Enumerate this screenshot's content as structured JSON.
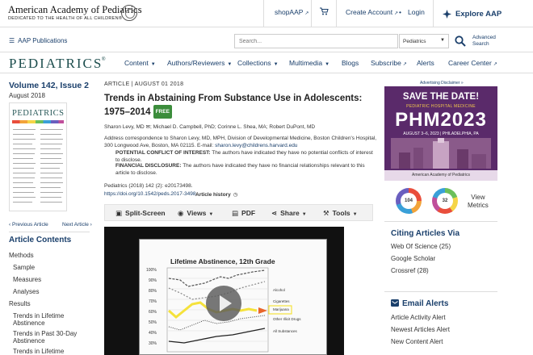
{
  "header": {
    "org_name": "American Academy of Pediatrics",
    "org_tagline": "DEDICATED TO THE HEALTH OF ALL CHILDREN®",
    "shop_label": "shopAAP",
    "create_account_label": "Create Account",
    "login_label": "Login",
    "explore_label": "Explore AAP"
  },
  "subbar": {
    "publications_label": "AAP Publications",
    "search_placeholder": "Search...",
    "search_scope": "Pediatrics",
    "advanced_search_line1": "Advanced",
    "advanced_search_line2": "Search"
  },
  "nav": {
    "journal_logo": "PEDIATRICS",
    "items": [
      "Content",
      "Authors/Reviewers",
      "Collections",
      "Multimedia",
      "Blogs",
      "Subscribe",
      "Alerts",
      "Career Center"
    ]
  },
  "issue": {
    "volume": "Volume 142, Issue 2",
    "date": "August 2018",
    "cover_title": "PEDIATRICS",
    "previous": "Previous Article",
    "next": "Next Article"
  },
  "toc": {
    "title": "Article Contents",
    "items": [
      "Methods",
      "Sample",
      "Measures",
      "Analyses",
      "Results",
      "Trends in Lifetime Abstinence",
      "Trends in Past 30-Day Abstinence",
      "Trends in Lifetime"
    ]
  },
  "article": {
    "type": "ARTICLE",
    "date": "AUGUST 01 2018",
    "title": "Trends in Abstaining From Substance Use in Adolescents: 1975–2014",
    "free_badge": "FREE",
    "authors": "Sharon Levy, MD ✉; Michael D. Campbell, PhD; Corinne L. Shea, MA; Robert DuPont, MD",
    "address": "Address correspondence to Sharon Levy, MD, MPH, Division of Developmental Medicine, Boston Children's Hospital, 300 Longwood Ave, Boston, MA 02115. E-mail: ",
    "email": "sharon.levy@childrens.harvard.edu",
    "coi_label": "POTENTIAL CONFLICT OF INTEREST:",
    "coi_text": " The authors have indicated they have no potential conflicts of interest to disclose.",
    "disclosure_label": "FINANCIAL DISCLOSURE:",
    "disclosure_text": " The authors have indicated they have no financial relationships relevant to this article to disclose.",
    "citation": "Pediatrics (2018) 142 (2): e20173498.",
    "doi": "https://doi.org/10.1542/peds.2017-3498",
    "history_label": "Article history"
  },
  "toolbar": {
    "split_screen": "Split-Screen",
    "views": "Views",
    "pdf": "PDF",
    "share": "Share",
    "tools": "Tools"
  },
  "video": {
    "slide_title": "Lifetime Abstinence, 12th Grade",
    "legend": [
      "Alcohol",
      "Cigarettes",
      "Marijuana",
      "Other Illicit Drugs",
      "All Substances"
    ]
  },
  "sidebar": {
    "ad_note": "Advertising Disclaimer »",
    "ad_save": "SAVE THE DATE!",
    "ad_sub": "PEDIATRIC HOSPITAL MEDICINE",
    "ad_phm": "PHM2023",
    "ad_date": "AUGUST 3–6, 2023 | PHILADELPHIA, PA",
    "ad_org": "American Academy of Pediatrics",
    "metric_left": "104",
    "metric_right": "32",
    "view_metrics_line1": "View",
    "view_metrics_line2": "Metrics",
    "citing_title": "Citing Articles Via",
    "citing_items": [
      "Web Of Science (25)",
      "Google Scholar",
      "Crossref (28)"
    ],
    "alerts_title": "Email Alerts",
    "alert_items": [
      "Article Activity Alert",
      "Newest Articles Alert",
      "New Content Alert"
    ]
  },
  "colors": {
    "link_blue": "#1a3f6b",
    "journal_teal": "#1c4d4d",
    "free_green": "#3c8d3c",
    "ad_purple": "#5a2a6a"
  }
}
